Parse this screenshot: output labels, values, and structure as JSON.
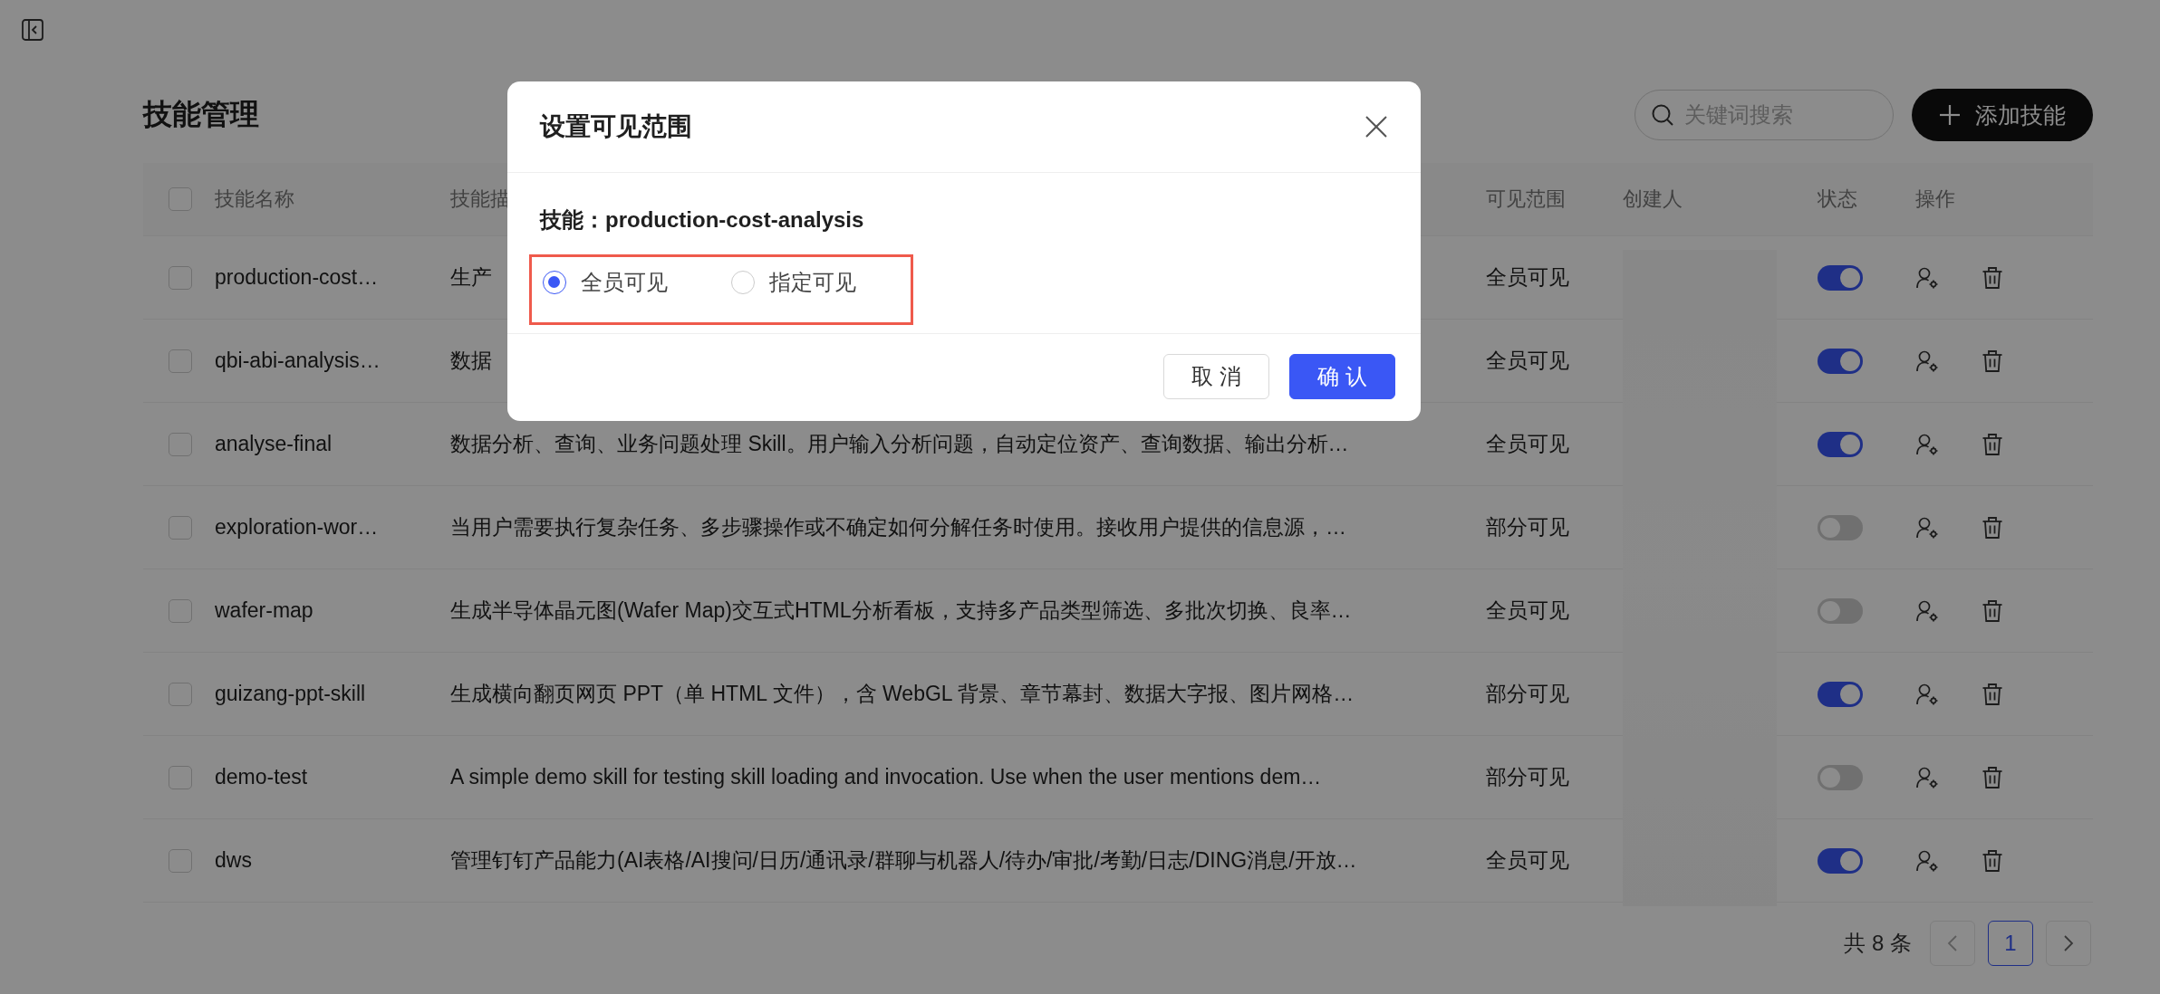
{
  "page": {
    "title": "技能管理"
  },
  "search": {
    "placeholder": "关键词搜索"
  },
  "add_button": {
    "label": "添加技能"
  },
  "table": {
    "select_all_checked": false,
    "columns": [
      "技能名称",
      "技能描",
      "可见范围",
      "创建人",
      "状态",
      "操作"
    ],
    "rows": [
      {
        "checked": false,
        "name": "production-cost…",
        "description": "生产",
        "visibility": "全员可见",
        "enabled": true
      },
      {
        "checked": false,
        "name": "qbi-abi-analysis…",
        "description": "数据",
        "visibility": "全员可见",
        "enabled": true
      },
      {
        "checked": false,
        "name": "analyse-final",
        "description": "数据分析、查询、业务问题处理 Skill。用户输入分析问题，自动定位资产、查询数据、输出分析…",
        "visibility": "全员可见",
        "enabled": true
      },
      {
        "checked": false,
        "name": "exploration-wor…",
        "description": "当用户需要执行复杂任务、多步骤操作或不确定如何分解任务时使用。接收用户提供的信息源，…",
        "visibility": "部分可见",
        "enabled": false
      },
      {
        "checked": false,
        "name": "wafer-map",
        "description": "生成半导体晶元图(Wafer Map)交互式HTML分析看板，支持多产品类型筛选、多批次切换、良率…",
        "visibility": "全员可见",
        "enabled": false
      },
      {
        "checked": false,
        "name": "guizang-ppt-skill",
        "description": "生成横向翻页网页 PPT（单 HTML 文件），含 WebGL 背景、章节幕封、数据大字报、图片网格…",
        "visibility": "部分可见",
        "enabled": true
      },
      {
        "checked": false,
        "name": "demo-test",
        "description": "A simple demo skill for testing skill loading and invocation. Use when the user mentions dem…",
        "visibility": "部分可见",
        "enabled": false
      },
      {
        "checked": false,
        "name": "dws",
        "description": "管理钉钉产品能力(AI表格/AI搜问/日历/通讯录/群聊与机器人/待办/审批/考勤/日志/DING消息/开放…",
        "visibility": "全员可见",
        "enabled": true
      }
    ]
  },
  "pagination": {
    "total": "共 8 条",
    "pages": [
      {
        "label": "1",
        "selected": true
      }
    ]
  },
  "dialog": {
    "title": "设置可见范围",
    "skill": "技能：production-cost-analysis",
    "options": [
      {
        "label": "全员可见",
        "selected": true
      },
      {
        "label": "指定可见",
        "selected": false
      }
    ],
    "buttons": [
      {
        "label": "取 消",
        "kind": "default"
      },
      {
        "label": "确 认",
        "kind": "primary"
      }
    ]
  }
}
